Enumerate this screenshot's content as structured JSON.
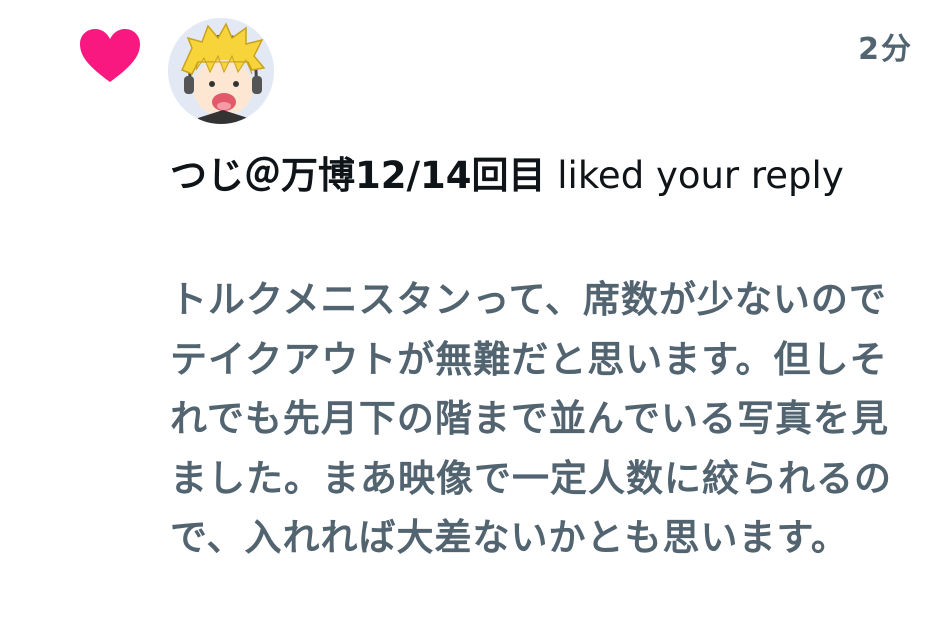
{
  "notification": {
    "type_icon": "heart-icon",
    "heart_color": "#f91880",
    "avatar_icon": "anime-avatar",
    "timestamp": "2分",
    "user_name": "つじ＠万博12/14回目",
    "action_text": " liked your reply",
    "reply_text": "トルクメニスタンって、席数が少ないのでテイクアウトが無難だと思います。但しそれでも先月下の階まで並んでいる写真を見ました。まあ映像で一定人数に絞られるので、入れれば大差ないかとも思います。"
  }
}
